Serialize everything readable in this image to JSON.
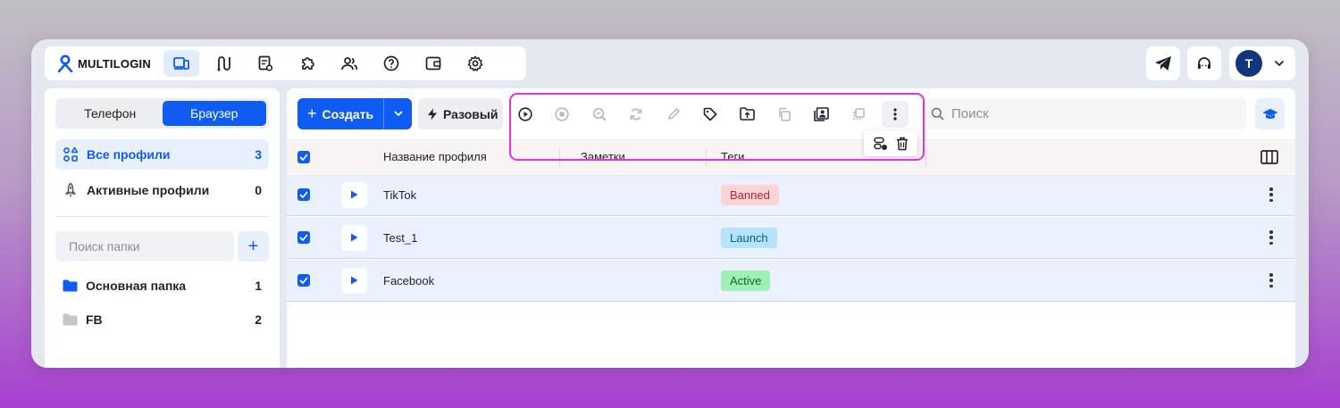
{
  "app": {
    "logo_text": "MULTILOGIN",
    "accent_color": "#0e5cf1",
    "nav_icons": [
      "devices-icon",
      "routes-icon",
      "scripts-icon",
      "extensions-icon",
      "team-icon",
      "help-icon",
      "wallet-icon",
      "settings-icon"
    ],
    "right_icons": [
      "telegram-icon",
      "support-icon"
    ],
    "avatar_letter": "T"
  },
  "sidebar": {
    "toggle": {
      "phone": "Телефон",
      "browser": "Браузер"
    },
    "items": [
      {
        "label": "Все профили",
        "count": "3"
      },
      {
        "label": "Активные профили",
        "count": "0"
      }
    ],
    "folder_search_placeholder": "Поиск папки",
    "add_label": "+",
    "folders": [
      {
        "label": "Основная папка",
        "count": "1",
        "color": "#0e5cf1"
      },
      {
        "label": "FB",
        "count": "2",
        "color": "#c4c6cc"
      }
    ]
  },
  "main": {
    "create_label": "Создать",
    "oneoff_label": "Разовый",
    "search_placeholder": "Поиск",
    "columns": {
      "name": "Название профиля",
      "notes": "Заметки",
      "tags": "Теги"
    },
    "rows": [
      {
        "name": "TikTok",
        "tag": "Banned",
        "tag_bg": "#fbd4d6",
        "tag_color": "#b0252e"
      },
      {
        "name": "Test_1",
        "tag": "Launch",
        "tag_bg": "#b5e3fa",
        "tag_color": "#0a5f8c"
      },
      {
        "name": "Facebook",
        "tag": "Active",
        "tag_bg": "#9fefb6",
        "tag_color": "#106b2a"
      }
    ]
  }
}
